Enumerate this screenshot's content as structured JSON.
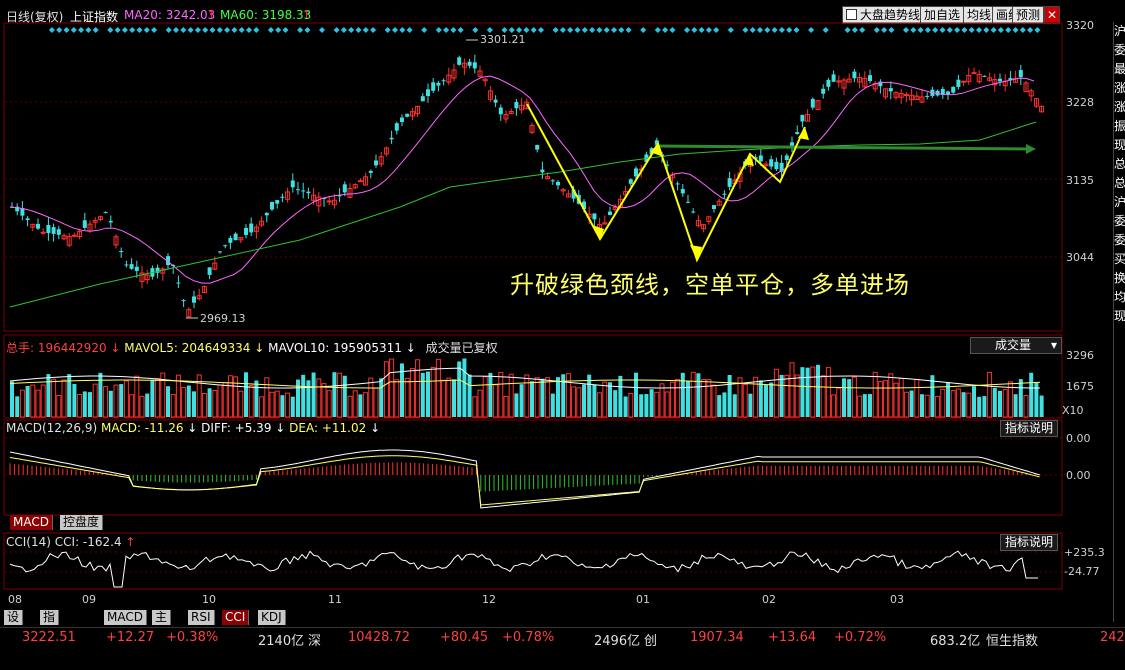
{
  "toolbar": {
    "period": "日线(复权)",
    "index_name": "上证指数",
    "ma20": "MA20: 3242.03",
    "ma60": "MA60: 3198.33",
    "checkbox_label": "大盘趋势线",
    "btn_add": "加自选",
    "btn_avg": "均线",
    "btn_compare": "画线",
    "btn_forecast": "预测"
  },
  "price_axis": [
    "3320",
    "3228",
    "3135",
    "3044"
  ],
  "price_marks": {
    "high": "3301.21",
    "low": "2969.13"
  },
  "annotation": "升破绿色颈线，空单平仓，多单进场",
  "volume": {
    "label": "总手:",
    "value": "196442920",
    "mavol5": "MAVOL5: 204649334",
    "mavol10": "MAVOL10: 195905311",
    "note": "成交量已复权",
    "selector": "成交量",
    "axis": [
      "3296",
      "1675"
    ],
    "unit": "X10"
  },
  "macd": {
    "label": "MACD(12,26,9)",
    "macd": "MACD: -11.26",
    "diff": "DIFF: +5.39",
    "dea": "DEA: +11.02",
    "help": "指标说明",
    "axis": [
      "0.00",
      "0.00"
    ],
    "tab1": "MACD",
    "tab2": "控盘度"
  },
  "cci": {
    "label": "CCI(14)",
    "value": "CCI: -162.4",
    "help": "指标说明",
    "axis": [
      "+235.3",
      "-24.77"
    ]
  },
  "x_axis": [
    "08",
    "09",
    "10",
    "11",
    "12",
    "01",
    "02",
    "03"
  ],
  "bottom_tabs": [
    "设置",
    "指标平台",
    "MACD",
    "主力",
    "RSI",
    "CCI",
    "KDJ"
  ],
  "status": {
    "sh_price": "3222.51",
    "sh_change": "+12.27",
    "sh_pct": "+0.38%",
    "sh_vol": "2140亿",
    "sz_name": "深",
    "sz_price": "10428.72",
    "sz_change": "+80.45",
    "sz_pct": "+0.78%",
    "sz_vol": "2496亿",
    "cy_name": "创",
    "cy_price": "1907.34",
    "cy_change": "+13.64",
    "cy_pct": "+0.72%",
    "cy_vol": "683.2亿",
    "hs_name": "恒生指数",
    "hs_price": "242"
  },
  "right_panel": [
    "沪",
    "委",
    "最",
    "涨",
    "涨",
    "振",
    "现",
    "总",
    "总",
    "沪",
    "委",
    "委",
    "买",
    "换",
    "均",
    "现"
  ]
}
